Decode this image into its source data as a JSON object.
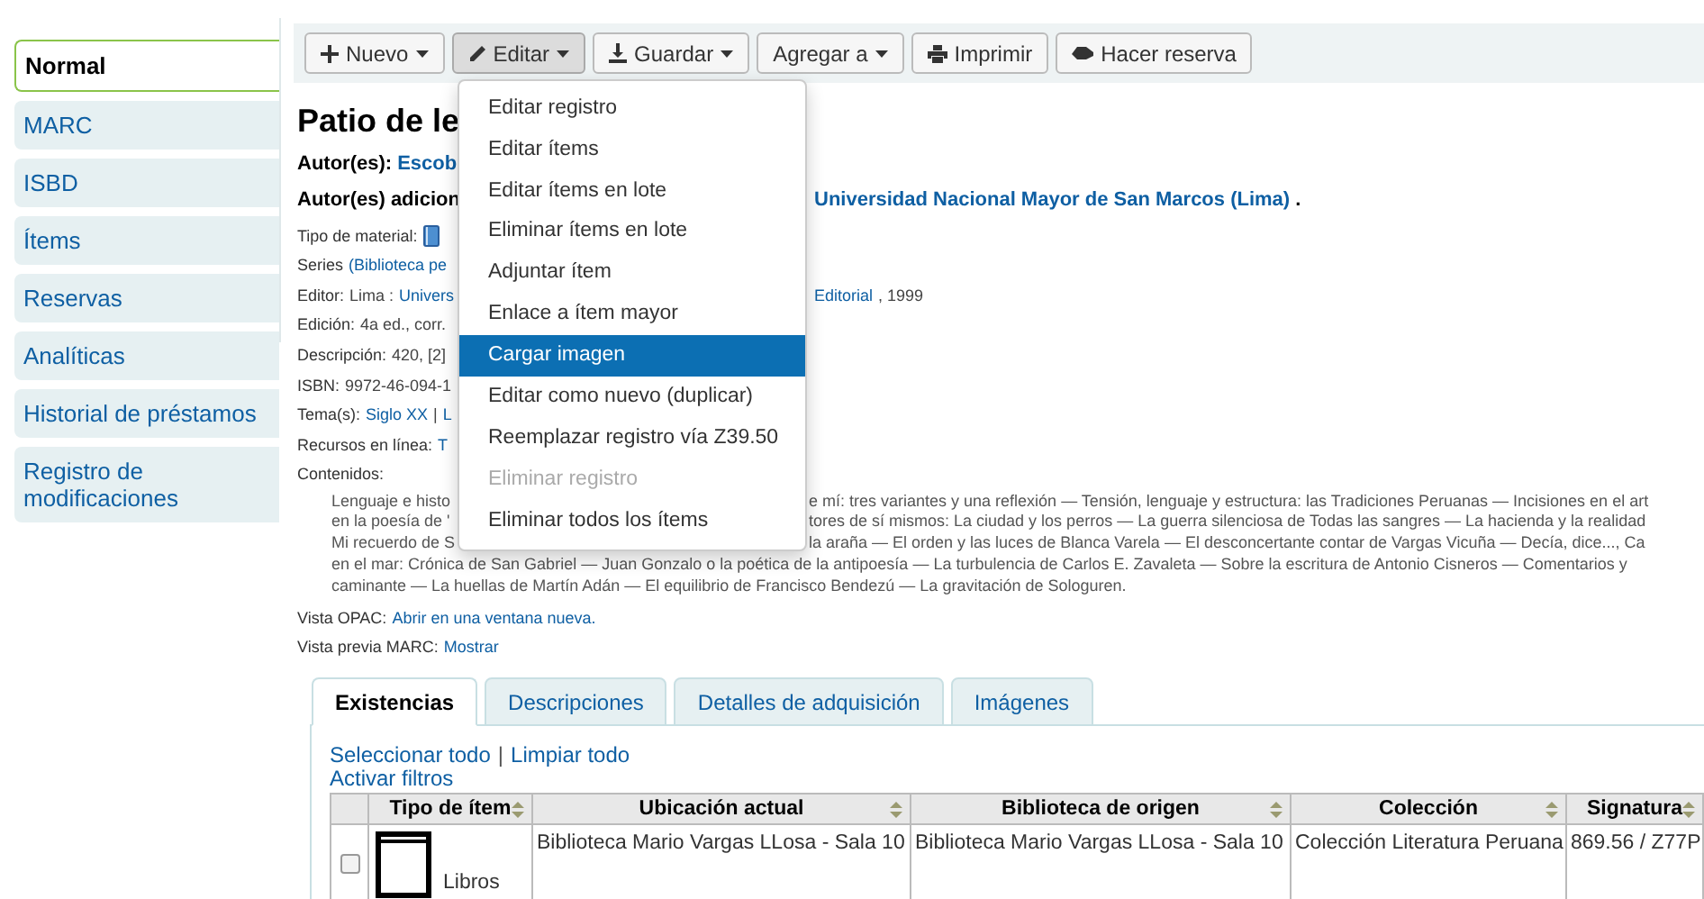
{
  "sidebar": {
    "items": [
      {
        "label": "Normal",
        "selected": true
      },
      {
        "label": "MARC",
        "selected": false
      },
      {
        "label": "ISBD",
        "selected": false
      },
      {
        "label": "Ítems",
        "selected": false
      },
      {
        "label": "Reservas",
        "selected": false
      },
      {
        "label": "Analíticas",
        "selected": false
      },
      {
        "label": "Historial de préstamos",
        "selected": false
      },
      {
        "label": "Registro de modificaciones",
        "selected": false
      }
    ]
  },
  "toolbar": {
    "buttons": [
      {
        "label": "Nuevo",
        "dropdown": true,
        "active": false
      },
      {
        "label": "Editar",
        "dropdown": true,
        "active": true
      },
      {
        "label": "Guardar",
        "dropdown": true,
        "active": false
      },
      {
        "label": "Agregar a",
        "dropdown": true,
        "active": false
      },
      {
        "label": "Imprimir",
        "dropdown": false,
        "active": false
      },
      {
        "label": "Hacer reserva",
        "dropdown": false,
        "active": false
      }
    ]
  },
  "menu": {
    "items": [
      {
        "label": "Editar registro",
        "selected": false,
        "disabled": false
      },
      {
        "label": "Editar ítems",
        "selected": false,
        "disabled": false
      },
      {
        "label": "Editar ítems en lote",
        "selected": false,
        "disabled": false
      },
      {
        "label": "Eliminar ítems en lote",
        "selected": false,
        "disabled": false
      },
      {
        "label": "Adjuntar ítem",
        "selected": false,
        "disabled": false
      },
      {
        "label": "Enlace a ítem mayor",
        "selected": false,
        "disabled": false
      },
      {
        "label": "Cargar imagen",
        "selected": true,
        "disabled": false
      },
      {
        "label": "Editar como nuevo (duplicar)",
        "selected": false,
        "disabled": false
      },
      {
        "label": "Reemplazar registro vía Z39.50",
        "selected": false,
        "disabled": false
      },
      {
        "label": "Eliminar registro",
        "selected": false,
        "disabled": true
      },
      {
        "label": "Eliminar todos los ítems",
        "selected": false,
        "disabled": false
      }
    ]
  },
  "record": {
    "title": "Patio de le",
    "authors": [
      {
        "left": [
          {
            "kind": "label",
            "text": "Autor(es):"
          },
          {
            "kind": "link",
            "text": "Escob"
          }
        ]
      },
      {
        "left": [
          {
            "kind": "label",
            "text": "Autor(es) adicion"
          }
        ],
        "right": [
          {
            "kind": "link",
            "text": "Universidad Nacional Mayor de San Marcos (Lima)"
          },
          {
            "kind": "label",
            "text": "."
          }
        ]
      }
    ],
    "fields": [
      {
        "left": [
          {
            "kind": "label",
            "text": "Tipo de material:"
          },
          {
            "kind": "icon"
          }
        ]
      },
      {
        "left": [
          {
            "kind": "label",
            "text": "Series"
          },
          {
            "kind": "link",
            "text": "(Biblioteca pe"
          }
        ]
      },
      {
        "left": [
          {
            "kind": "label",
            "text": "Editor:"
          },
          {
            "kind": "text",
            "text": "Lima :"
          },
          {
            "kind": "link",
            "text": "Univers"
          }
        ],
        "right": [
          {
            "kind": "link",
            "text": "Editorial"
          },
          {
            "kind": "text",
            "text": ", 1999"
          }
        ]
      },
      {
        "left": [
          {
            "kind": "label",
            "text": "Edición:"
          },
          {
            "kind": "text",
            "text": "4a ed., corr."
          }
        ]
      },
      {
        "left": [
          {
            "kind": "label",
            "text": "Descripción:"
          },
          {
            "kind": "text",
            "text": "420, [2]"
          }
        ]
      },
      {
        "left": [
          {
            "kind": "label",
            "text": "ISBN:"
          },
          {
            "kind": "text",
            "text": "9972-46-094-1"
          }
        ]
      },
      {
        "left": [
          {
            "kind": "label",
            "text": "Tema(s):"
          },
          {
            "kind": "link",
            "text": "Siglo XX"
          },
          {
            "kind": "text",
            "text": "|"
          },
          {
            "kind": "link",
            "text": "L"
          }
        ]
      },
      {
        "left": [
          {
            "kind": "label",
            "text": "Recursos en línea:"
          },
          {
            "kind": "link",
            "text": "T"
          }
        ]
      },
      {
        "left": [
          {
            "kind": "label",
            "text": "Contenidos:"
          }
        ]
      }
    ],
    "contents": [
      {
        "left": "Lenguaje e histo",
        "right": "e mí: tres variantes y una reflexión — Tensión, lenguaje y estructura: las Tradiciones Peruanas — Incisiones en el art"
      },
      {
        "left": "en la poesía de '",
        "right": "tores de sí mismos: La ciudad y los perros — La guerra silenciosa de Todas las sangres — La hacienda y la realidad"
      },
      {
        "left": "Mi recuerdo de S",
        "right": "la araña — El orden y las luces de Blanca Varela — El desconcertante contar de Vargas Vicuña — Decía, dice..., Ca"
      },
      {
        "left": "en el mar: Crónica de San Gabriel — Juan Gonzalo o la poética de la antipoesía — La turbulencia de Carlos E. Zavaleta — Sobre la escritura de Antonio Cisneros — Comentarios y"
      },
      {
        "left": "caminante — La huellas de Martín Adán — El equilibrio de Francisco Bendezú — La gravitación de Sologuren."
      }
    ],
    "views": [
      {
        "left": [
          {
            "kind": "label",
            "text": "Vista OPAC:"
          },
          {
            "kind": "link",
            "text": "Abrir en una ventana nueva."
          }
        ]
      },
      {
        "left": [
          {
            "kind": "label",
            "text": "Vista previa MARC:"
          },
          {
            "kind": "link",
            "text": "Mostrar"
          }
        ]
      }
    ]
  },
  "tabs": [
    {
      "label": "Existencias",
      "selected": true
    },
    {
      "label": "Descripciones",
      "selected": false
    },
    {
      "label": "Detalles de adquisición",
      "selected": false
    },
    {
      "label": "Imágenes",
      "selected": false
    }
  ],
  "holdings": {
    "select_all": "Seleccionar todo",
    "separator": "|",
    "clear_all": "Limpiar todo",
    "filters": "Activar filtros",
    "columns": [
      "Tipo de ítem",
      "Ubicación actual",
      "Biblioteca de origen",
      "Colección",
      "Signatura"
    ],
    "rows": [
      {
        "checked": false,
        "item_type": "Libros",
        "location": "Biblioteca Mario Vargas LLosa - Sala 10",
        "home_library": "Biblioteca Mario Vargas LLosa - Sala 10",
        "collection": "Colección Literatura Peruana",
        "call_number": "869.56 / Z77P"
      }
    ]
  }
}
